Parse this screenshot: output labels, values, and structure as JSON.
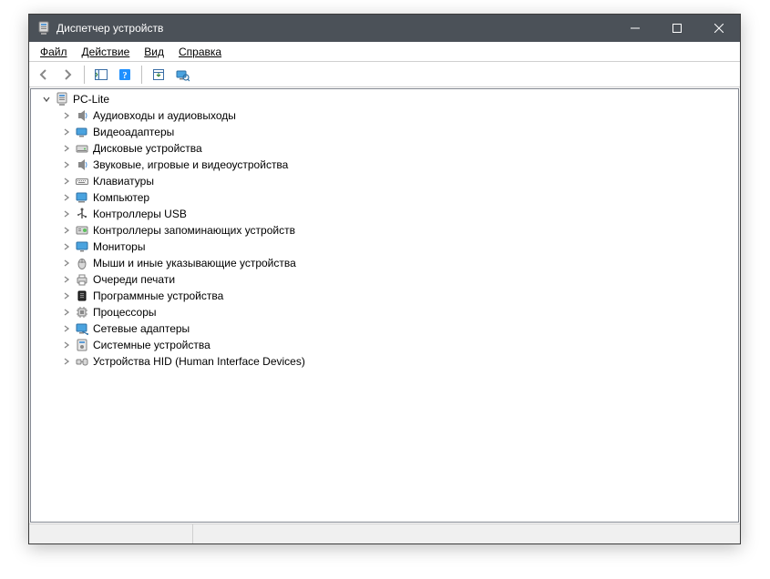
{
  "window": {
    "title": "Диспетчер устройств"
  },
  "menu": {
    "file": "Файл",
    "action": "Действие",
    "view": "Вид",
    "help": "Справка"
  },
  "tree": {
    "root": "PC-Lite",
    "items": [
      {
        "key": "audio",
        "label": "Аудиовходы и аудиовыходы"
      },
      {
        "key": "video",
        "label": "Видеоадаптеры"
      },
      {
        "key": "disk",
        "label": "Дисковые устройства"
      },
      {
        "key": "soundgame",
        "label": "Звуковые, игровые и видеоустройства"
      },
      {
        "key": "keyboard",
        "label": "Клавиатуры"
      },
      {
        "key": "computer",
        "label": "Компьютер"
      },
      {
        "key": "usb",
        "label": "Контроллеры USB"
      },
      {
        "key": "storagectl",
        "label": "Контроллеры запоминающих устройств"
      },
      {
        "key": "monitor",
        "label": "Мониторы"
      },
      {
        "key": "mouse",
        "label": "Мыши и иные указывающие устройства"
      },
      {
        "key": "printqueue",
        "label": "Очереди печати"
      },
      {
        "key": "software",
        "label": "Программные устройства"
      },
      {
        "key": "cpu",
        "label": "Процессоры"
      },
      {
        "key": "network",
        "label": "Сетевые адаптеры"
      },
      {
        "key": "system",
        "label": "Системные устройства"
      },
      {
        "key": "hid",
        "label": "Устройства HID (Human Interface Devices)"
      }
    ]
  }
}
